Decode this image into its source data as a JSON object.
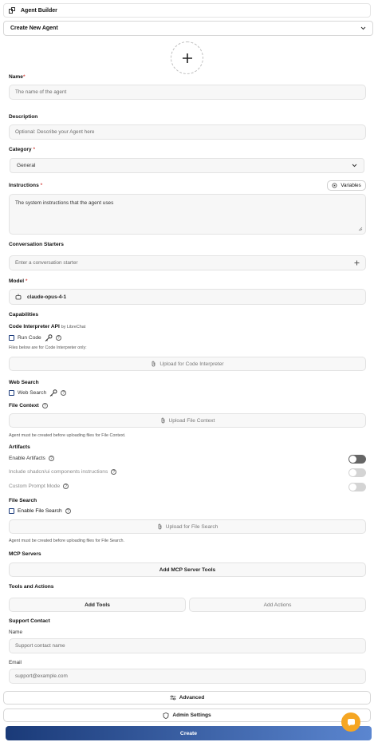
{
  "header": {
    "title": "Agent Builder"
  },
  "agent_select": {
    "value": "Create New Agent"
  },
  "name": {
    "label": "Name",
    "required_mark": "*",
    "placeholder": "The name of the agent"
  },
  "description": {
    "label": "Description",
    "placeholder": "Optional: Describe your Agent here"
  },
  "category": {
    "label": "Category",
    "required_mark": "*",
    "value": "General"
  },
  "instructions": {
    "label": "Instructions",
    "required_mark": "*",
    "variables_label": "Variables",
    "placeholder": "The system instructions that the agent uses"
  },
  "starters": {
    "label": "Conversation Starters",
    "placeholder": "Enter a conversation starter"
  },
  "model": {
    "label": "Model",
    "required_mark": "*",
    "value": "claude-opus-4-1"
  },
  "capabilities": {
    "label": "Capabilities",
    "code_interpreter": {
      "label": "Code Interpreter API",
      "by": "by LibreChat",
      "run_code": "Run Code",
      "note": "Files below are for Code Interpreter only:",
      "upload": "Upload for Code Interpreter"
    },
    "web_search": {
      "label": "Web Search",
      "option": "Web Search"
    },
    "file_context": {
      "label": "File Context",
      "upload": "Upload File Context",
      "note": "Agent must be created before uploading files for File Context."
    },
    "artifacts": {
      "label": "Artifacts",
      "enable": "Enable Artifacts",
      "shadcn": "Include shadcn/ui components instructions",
      "custom_prompt": "Custom Prompt Mode"
    },
    "file_search": {
      "label": "File Search",
      "enable": "Enable File Search",
      "upload": "Upload for File Search",
      "note": "Agent must be created before uploading files for File Search."
    }
  },
  "mcp": {
    "label": "MCP Servers",
    "button": "Add MCP Server Tools"
  },
  "tools": {
    "label": "Tools and Actions",
    "add_tools": "Add Tools",
    "add_actions": "Add Actions"
  },
  "support": {
    "label": "Support Contact",
    "name_label": "Name",
    "name_placeholder": "Support contact name",
    "email_label": "Email",
    "email_placeholder": "support@example.com"
  },
  "footer": {
    "advanced": "Advanced",
    "admin": "Admin Settings",
    "create": "Create"
  },
  "colors": {
    "primary": "#1f3e78",
    "create_start": "#1a3a78",
    "create_end": "#5b86d0",
    "chat_fab": "#f5a623",
    "toggle_on": "#666666",
    "toggle_off": "#d4d4d4"
  }
}
